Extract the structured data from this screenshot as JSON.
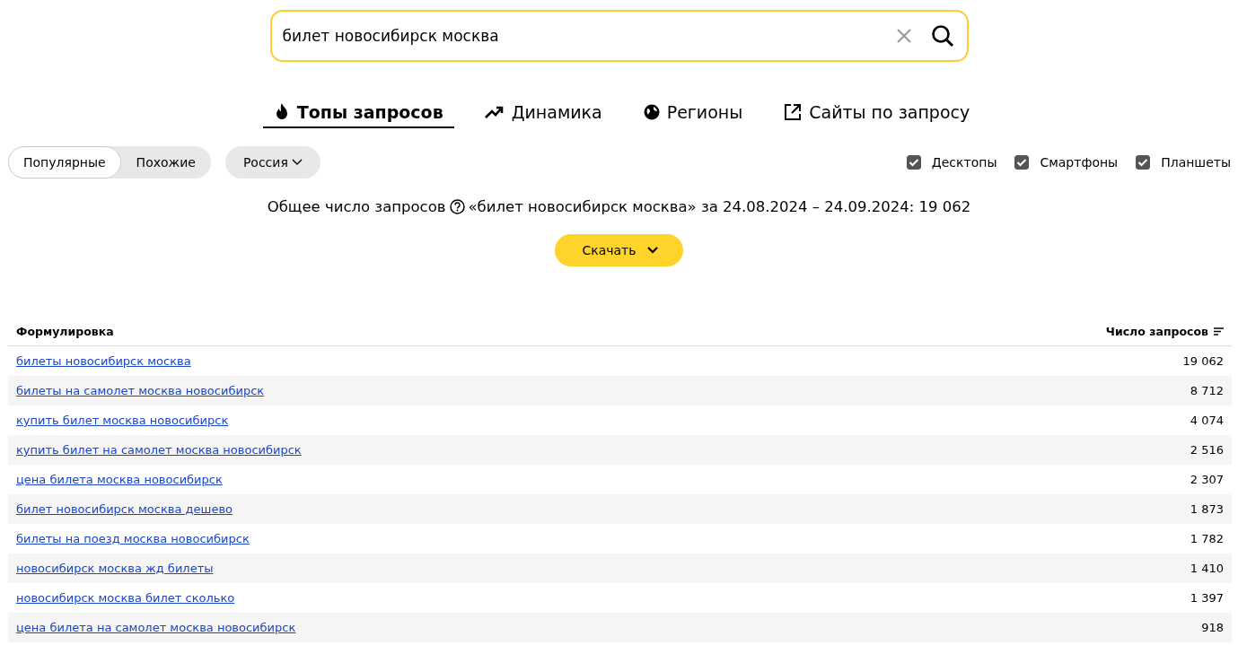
{
  "search": {
    "value": "билет новосибирск москва"
  },
  "tabs": [
    {
      "label": "Топы запросов",
      "selected": true
    },
    {
      "label": "Динамика",
      "selected": false
    },
    {
      "label": "Регионы",
      "selected": false
    },
    {
      "label": "Сайты по запросу",
      "selected": false
    }
  ],
  "modes": [
    {
      "label": "Популярные",
      "selected": true
    },
    {
      "label": "Похожие",
      "selected": false
    }
  ],
  "region": {
    "label": "Россия"
  },
  "devices": [
    {
      "label": "Десктопы",
      "checked": true
    },
    {
      "label": "Смартфоны",
      "checked": true
    },
    {
      "label": "Планшеты",
      "checked": true
    }
  ],
  "summary": {
    "label": "Общее число запросов",
    "text": "«билет новосибирск москва» за 24.08.2024 – 24.09.2024: 19 062"
  },
  "download": {
    "label": "Скачать"
  },
  "table": {
    "columns": [
      "Формулировка",
      "Число запросов"
    ],
    "rows": [
      {
        "phrase": "билеты новосибирск москва",
        "count": "19 062"
      },
      {
        "phrase": "билеты на самолет москва новосибирск",
        "count": "8 712"
      },
      {
        "phrase": "купить билет москва новосибирск",
        "count": "4 074"
      },
      {
        "phrase": "купить билет на самолет москва новосибирск",
        "count": "2 516"
      },
      {
        "phrase": "цена билета москва новосибирск",
        "count": "2 307"
      },
      {
        "phrase": "билет новосибирск москва дешево",
        "count": "1 873"
      },
      {
        "phrase": "билеты на поезд москва новосибирск",
        "count": "1 782"
      },
      {
        "phrase": "новосибирск москва жд билеты",
        "count": "1 410"
      },
      {
        "phrase": "новосибирск москва билет сколько",
        "count": "1 397"
      },
      {
        "phrase": "цена билета на самолет москва новосибирск",
        "count": "918"
      }
    ]
  }
}
